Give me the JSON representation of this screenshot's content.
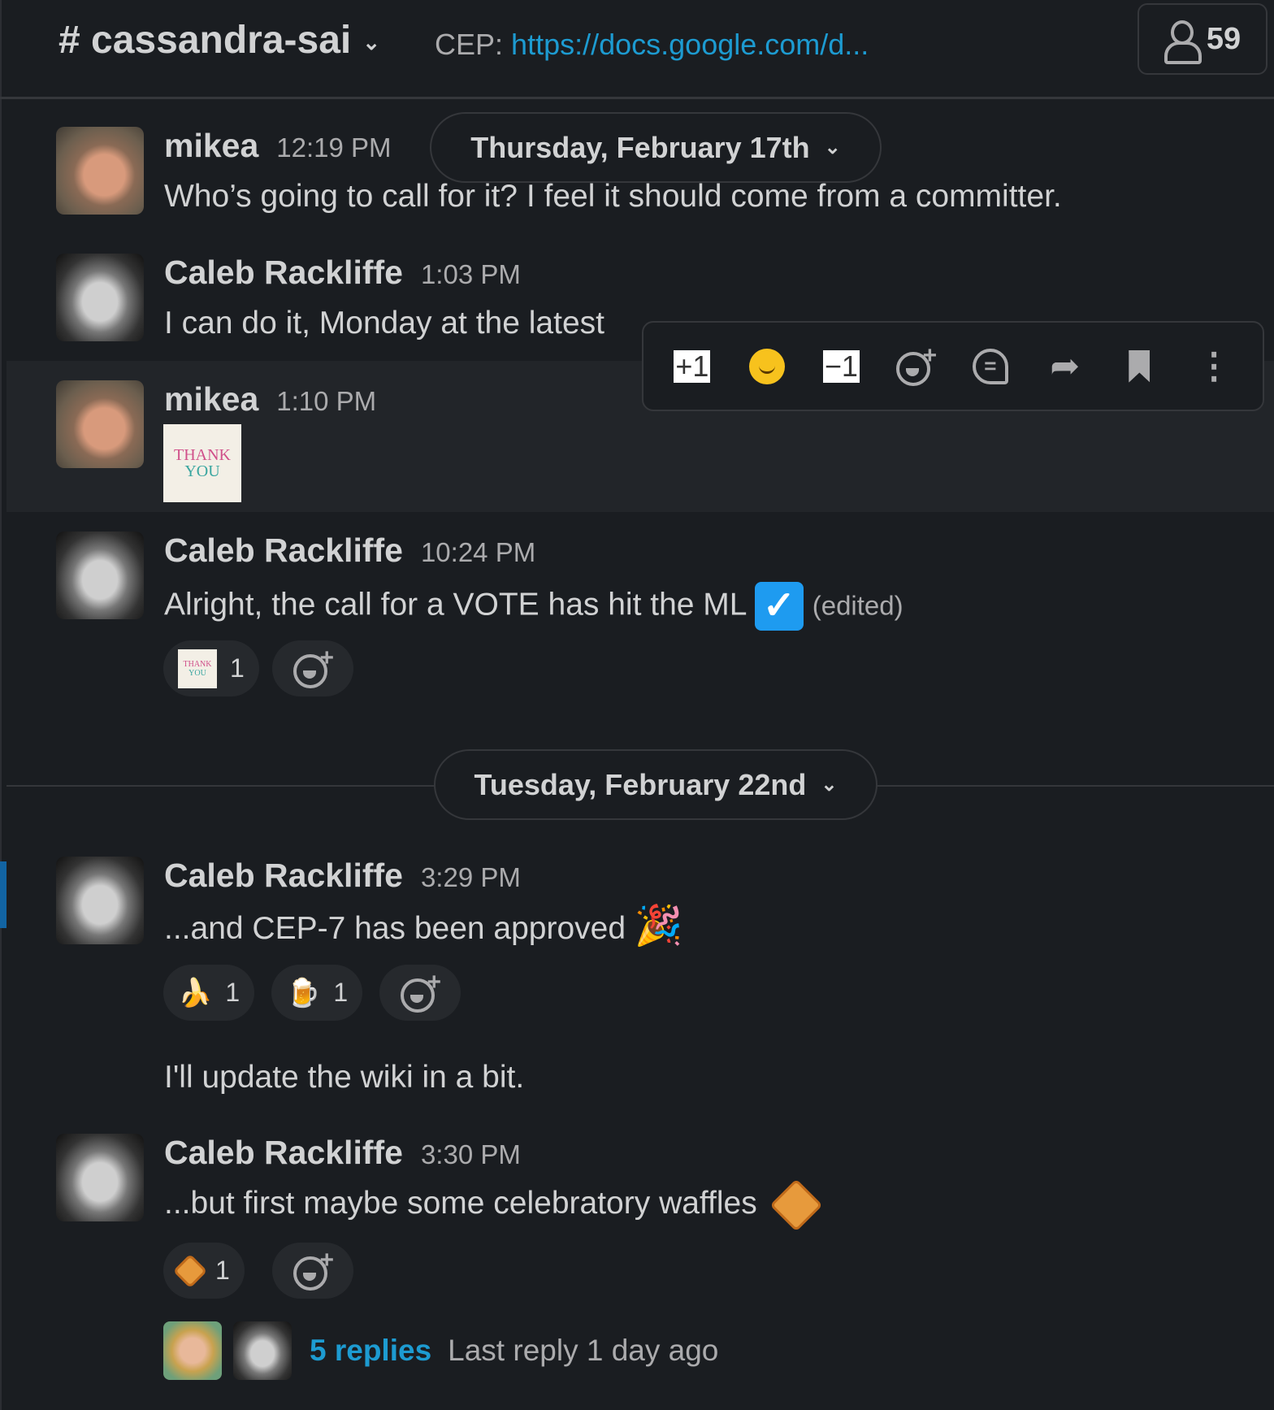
{
  "header": {
    "channel": "# cassandra-sai",
    "topic_prefix": "CEP:",
    "topic_link": "https://docs.google.com/d...",
    "member_count": "59"
  },
  "date_dividers": [
    "Thursday, February 17th",
    "Tuesday, February 22nd"
  ],
  "toolbar": {
    "plus_one": "+1",
    "minus_one": "−1",
    "icons": [
      "plus-one-emoji",
      "slightly-smiling-emoji",
      "minus-one-emoji",
      "add-reaction-icon",
      "reply-thread-icon",
      "share-icon",
      "bookmark-icon",
      "more-actions-icon"
    ]
  },
  "messages": [
    {
      "author": "mikea",
      "time": "12:19 PM",
      "text": "Who’s going to call for it? I feel it should come from a committer."
    },
    {
      "author": "Caleb Rackliffe",
      "time": "1:03 PM",
      "text": "I can do it, Monday at the latest"
    },
    {
      "author": "mikea",
      "time": "1:10 PM",
      "sticker": [
        "THANK",
        "YOU"
      ]
    },
    {
      "author": "Caleb Rackliffe",
      "time": "10:24 PM",
      "text": "Alright, the call for a VOTE has hit the ML",
      "edited": "(edited)",
      "reactions": [
        {
          "emoji": "thank-you",
          "count": "1"
        }
      ]
    },
    {
      "author": "Caleb Rackliffe",
      "time": "3:29 PM",
      "text": "...and CEP-7 has been approved",
      "reactions": [
        {
          "emoji": "dancing-banana",
          "count": "1"
        },
        {
          "emoji": "beer",
          "count": "1"
        }
      ],
      "followup": "I'll update the wiki in a bit."
    },
    {
      "author": "Caleb Rackliffe",
      "time": "3:30 PM",
      "text": "...but first maybe some celebratory waffles",
      "reactions": [
        {
          "emoji": "waffle",
          "count": "1"
        }
      ],
      "thread": {
        "replies": "5 replies",
        "last_reply": "Last reply 1 day ago"
      }
    }
  ],
  "colors": {
    "background": "#1a1d21",
    "link": "#1d9bd1",
    "accent_bar": "#1264a3",
    "text": "#d1d2d3",
    "muted": "#ababad"
  }
}
